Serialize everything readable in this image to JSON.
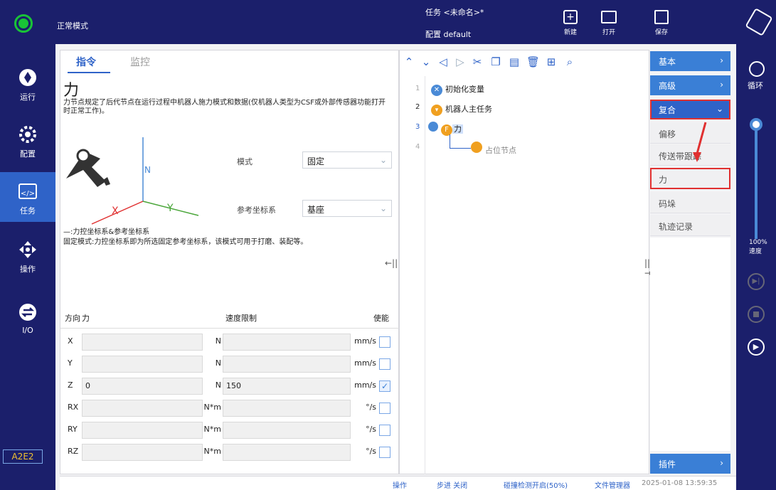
{
  "mode_label": "正常模式",
  "task_label": "任务 <未命名>*",
  "config_label": "配置 default",
  "toolbar": {
    "new": "新建",
    "open": "打开",
    "save": "保存"
  },
  "nav": [
    {
      "label": "运行"
    },
    {
      "label": "配置"
    },
    {
      "label": "任务"
    },
    {
      "label": "操作"
    },
    {
      "label": "I/O"
    }
  ],
  "device_id": "A2E2",
  "tabs": {
    "command": "指令",
    "monitor": "监控"
  },
  "panel": {
    "title": "力",
    "description": "力节点规定了后代节点在运行过程中机器人施力模式和数据(仅机器人类型为CSF或外部传感器功能打开时正常工作)。",
    "mode_label": "模式",
    "mode_value": "固定",
    "ref_label": "参考坐标系",
    "ref_value": "基座",
    "legend": "—:力控坐标系&参考坐标系",
    "fixed_desc": "固定模式:力控坐标系即为所选固定参考坐标系，该模式可用于打磨、装配等。"
  },
  "table": {
    "headers": [
      "方向",
      "力",
      "速度限制",
      "使能"
    ],
    "rows": [
      {
        "dir": "X",
        "force": "",
        "funit": "N",
        "speed": "",
        "sunit": "mm/s",
        "enabled": false
      },
      {
        "dir": "Y",
        "force": "",
        "funit": "N",
        "speed": "",
        "sunit": "mm/s",
        "enabled": false
      },
      {
        "dir": "Z",
        "force": "0",
        "funit": "N",
        "speed": "150",
        "sunit": "mm/s",
        "enabled": true
      },
      {
        "dir": "RX",
        "force": "",
        "funit": "N*m",
        "speed": "",
        "sunit": "°/s",
        "enabled": false
      },
      {
        "dir": "RY",
        "force": "",
        "funit": "N*m",
        "speed": "",
        "sunit": "°/s",
        "enabled": false
      },
      {
        "dir": "RZ",
        "force": "",
        "funit": "N*m",
        "speed": "",
        "sunit": "°/s",
        "enabled": false
      }
    ]
  },
  "tree": {
    "n1": "初始化变量",
    "n2": "机器人主任务",
    "n3": "力",
    "n4": "占位节点",
    "ln": [
      "1",
      "2",
      "3",
      "4"
    ]
  },
  "menu": {
    "basic": "基本",
    "advanced": "高级",
    "composite": "复合",
    "items": [
      "偏移",
      "传送带跟踪",
      "力",
      "码垛",
      "轨迹记录"
    ],
    "plugin": "插件"
  },
  "right": {
    "loop": "循环",
    "speed_pct": "100%",
    "speed": "速度"
  },
  "status": {
    "op": "操作",
    "step": "步进 关闭",
    "collision": "碰撞检测开启(50%)",
    "file": "文件管理器",
    "time": "2025-01-08 13:59:35"
  },
  "colors": {
    "bar": "#1b1f6b",
    "accent": "#2f63c8",
    "green": "#19c437"
  }
}
